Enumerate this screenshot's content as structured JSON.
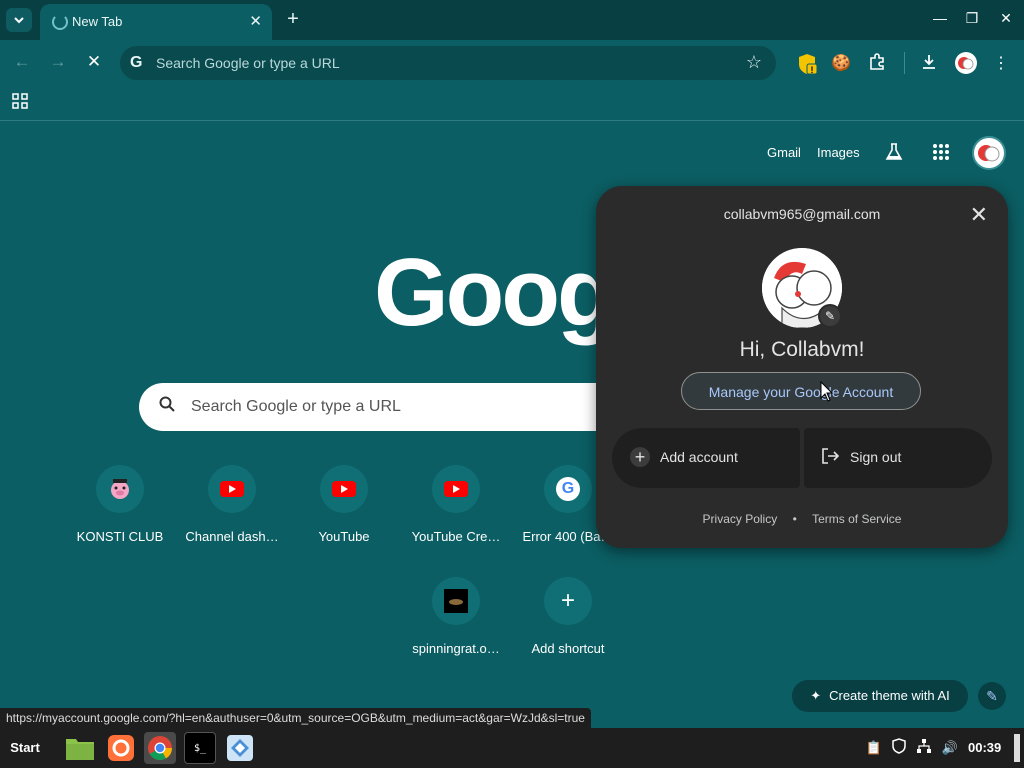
{
  "browser": {
    "tab_title": "New Tab",
    "new_tab_symbol": "+",
    "omnibox_placeholder": "Search Google or type a URL"
  },
  "ntp": {
    "header_links": [
      "Gmail",
      "Images"
    ],
    "logo_text": "Googl",
    "search_placeholder": "Search Google or type a URL",
    "shortcuts": [
      {
        "label": "KONSTI CLUB",
        "icon": "pig-favicon"
      },
      {
        "label": "Channel dash…",
        "icon": "youtube-icon"
      },
      {
        "label": "YouTube",
        "icon": "youtube-icon"
      },
      {
        "label": "YouTube Cre…",
        "icon": "youtube-icon"
      },
      {
        "label": "Error 400 (Ba…",
        "icon": "google-icon"
      },
      {
        "label": "spinningrat.o…",
        "icon": "rat-thumbnail"
      },
      {
        "label": "Add shortcut",
        "icon": "plus-icon"
      }
    ],
    "create_theme_label": "Create theme with AI"
  },
  "account_popup": {
    "email": "collabvm965@gmail.com",
    "greeting": "Hi, Collabvm!",
    "manage_label": "Manage your Google Account",
    "add_account_label": "Add account",
    "sign_out_label": "Sign out",
    "privacy_label": "Privacy Policy",
    "separator": "•",
    "terms_label": "Terms of Service"
  },
  "status_url": "https://myaccount.google.com/?hl=en&authuser=0&utm_source=OGB&utm_medium=act&gar=WzJd&sl=true",
  "taskbar": {
    "start_label": "Start",
    "clock": "00:39"
  },
  "colors": {
    "theme_bg": "#0b5e63",
    "frame": "#073f43",
    "popup_bg": "#2b2b2b",
    "link_blue": "#a8c7fa"
  }
}
